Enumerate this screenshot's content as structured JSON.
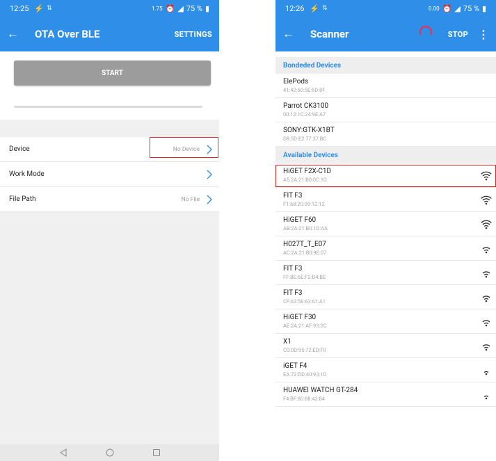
{
  "left": {
    "status": {
      "time": "12:25",
      "net_speed": "1.75",
      "battery": "75 %"
    },
    "appbar": {
      "title": "OTA Over BLE",
      "action": "SETTINGS"
    },
    "start_label": "START",
    "rows": [
      {
        "label": "Device",
        "value": "No Device"
      },
      {
        "label": "Work Mode",
        "value": ""
      },
      {
        "label": "File Path",
        "value": "No File"
      }
    ]
  },
  "right": {
    "status": {
      "time": "12:26",
      "net_speed": "0.00",
      "battery": "75 %"
    },
    "appbar": {
      "title": "Scanner",
      "action": "STOP"
    },
    "bonded_header": "Bondeded Devices",
    "bonded": [
      {
        "name": "ElePods",
        "addr": "41:42:60:5E:6D:8F"
      },
      {
        "name": "Parrot CK3100",
        "addr": "00:12:1C:24:9E:A7"
      },
      {
        "name": "SONY:GTK-X1BT",
        "addr": "D8:5D:E2:77:37:BC"
      }
    ],
    "available_header": "Available Devices",
    "available": [
      {
        "name": "HiGET F2X-C1D",
        "addr": "A5:2A:21:B0:0C:1D",
        "signal": 3
      },
      {
        "name": "FIT F3",
        "addr": "F1:68:20:09:12:12",
        "signal": 3
      },
      {
        "name": "HiGET F60",
        "addr": "AB:2A:21:B0:1D:AA",
        "signal": 3
      },
      {
        "name": "H027T_T_E07",
        "addr": "AC:2A:21:B0:9E:07",
        "signal": 2
      },
      {
        "name": "FIT F3",
        "addr": "FF:BE:6E:F2:D4:BE",
        "signal": 2
      },
      {
        "name": "FIT F3",
        "addr": "CF:63:56:63:61:A1",
        "signal": 2
      },
      {
        "name": "HiGET F30",
        "addr": "AE:2A:21:AF:93:2C",
        "signal": 2
      },
      {
        "name": "X1",
        "addr": "C0:0D:95:72:ED:F0",
        "signal": 2
      },
      {
        "name": "iGET F4",
        "addr": "EA:72:DD:40:93:1D",
        "signal": 1
      },
      {
        "name": "HUAWEI WATCH GT-284",
        "addr": "F4:BF:80:88:42:84",
        "signal": 1
      }
    ]
  },
  "colors": {
    "primary": "#2f8fe8",
    "highlight": "#e02424",
    "start_button": "#9c9c9c"
  }
}
